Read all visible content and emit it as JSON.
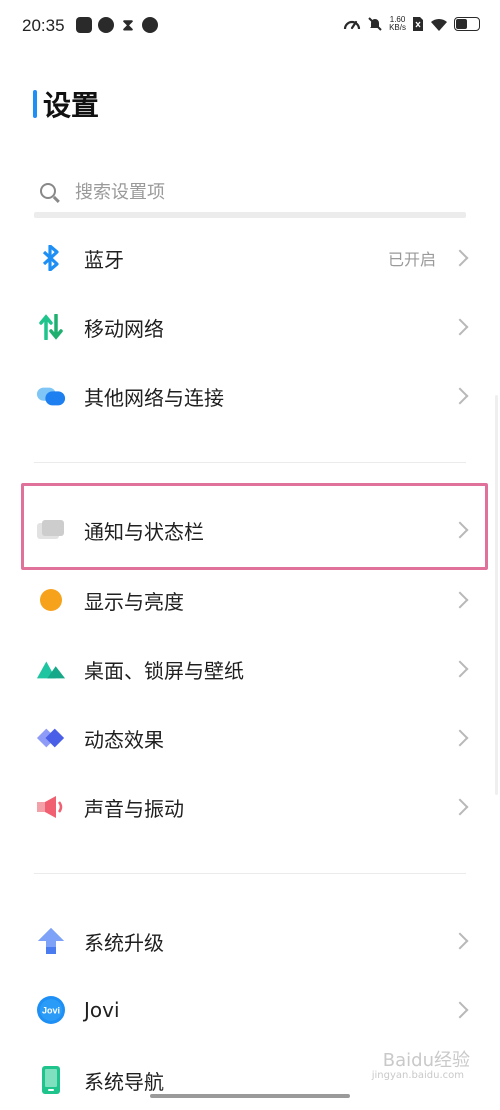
{
  "status_bar": {
    "time": "20:35",
    "net_speed_value": "1.60",
    "net_speed_unit": "KB/s",
    "left_icons": [
      "app-icon",
      "chat-icon",
      "hourglass-icon",
      "compass-icon"
    ],
    "right_icons": [
      "speed-icon",
      "mute-icon",
      "sim-icon",
      "wifi-icon",
      "battery-icon"
    ]
  },
  "page": {
    "title": "设置",
    "accent_color": "#1e8ff5"
  },
  "search": {
    "placeholder": "搜索设置项"
  },
  "settings": [
    {
      "label": "蓝牙",
      "status": "已开启",
      "icon": "bluetooth-icon",
      "color": "#1e8ff5"
    },
    {
      "label": "移动网络",
      "status": "",
      "icon": "mobile-data-icon",
      "color": "#1fc48c"
    },
    {
      "label": "其他网络与连接",
      "status": "",
      "icon": "connection-icon",
      "color": "#1e8ff5"
    },
    {
      "label": "通知与状态栏",
      "status": "",
      "icon": "notification-icon",
      "color": "#cfcfcf"
    },
    {
      "label": "显示与亮度",
      "status": "",
      "icon": "brightness-icon",
      "color": "#f7a21b"
    },
    {
      "label": "桌面、锁屏与壁纸",
      "status": "",
      "icon": "wallpaper-icon",
      "color": "#1fc4a0"
    },
    {
      "label": "动态效果",
      "status": "",
      "icon": "animation-icon",
      "color": "#5a6ef0"
    },
    {
      "label": "声音与振动",
      "status": "",
      "icon": "sound-icon",
      "color": "#f06070"
    },
    {
      "label": "系统升级",
      "status": "",
      "icon": "upgrade-icon",
      "color": "#4a7cf0"
    },
    {
      "label": "Jovi",
      "status": "",
      "icon": "jovi-icon",
      "color": "#1e8ff5"
    },
    {
      "label": "系统导航",
      "status": "",
      "icon": "navigation-icon",
      "color": "#1fc48c"
    }
  ],
  "highlight_color": "#e0719a",
  "watermark": {
    "text": "Baidu经验",
    "sub": "jingyan.baidu.com"
  }
}
